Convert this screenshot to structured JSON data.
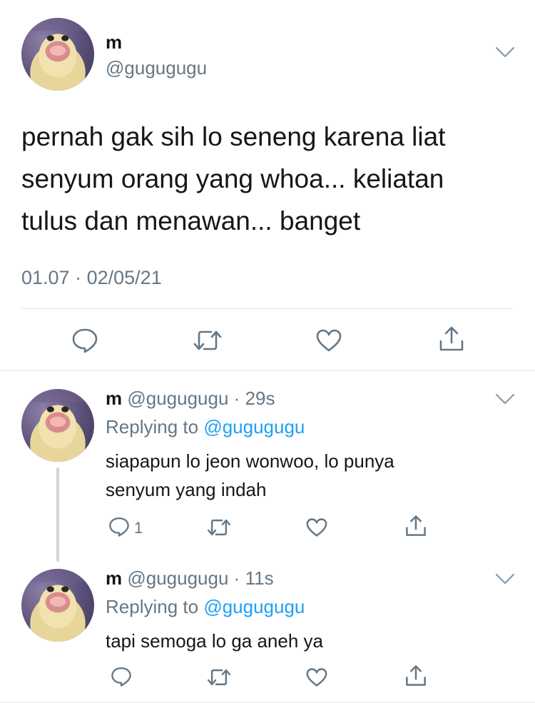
{
  "main_tweet": {
    "name": "m",
    "handle": "@gugugugu",
    "text_lines": [
      "pernah gak sih lo seneng karena liat",
      "senyum orang yang whoa... keliatan",
      "tulus dan menawan... banget"
    ],
    "time": "01.07",
    "separator": "·",
    "date": "02/05/21"
  },
  "replies": [
    {
      "name": "m",
      "handle": "@gugugugu",
      "separator": "·",
      "age": "29s",
      "replying_prefix": "Replying to",
      "replying_handle": "@gugugugu",
      "text_lines": [
        "siapapun lo jeon wonwoo, lo punya",
        "senyum yang indah"
      ],
      "reply_count": "1"
    },
    {
      "name": "m",
      "handle": "@gugugugu",
      "separator": "·",
      "age": "11s",
      "replying_prefix": "Replying to",
      "replying_handle": "@gugugugu",
      "text_lines": [
        "tapi semoga lo ga aneh ya"
      ],
      "reply_count": ""
    }
  ],
  "icons": {
    "reply": "speech-bubble-icon",
    "retweet": "retweet-arrows-icon",
    "like": "heart-icon",
    "share": "share-upload-icon",
    "menu": "chevron-down-icon"
  },
  "colors": {
    "text": "#14171a",
    "secondary": "#657786",
    "link": "#1da1f2",
    "divider": "#e1e8ed",
    "thread_line": "#ccd6dd"
  }
}
